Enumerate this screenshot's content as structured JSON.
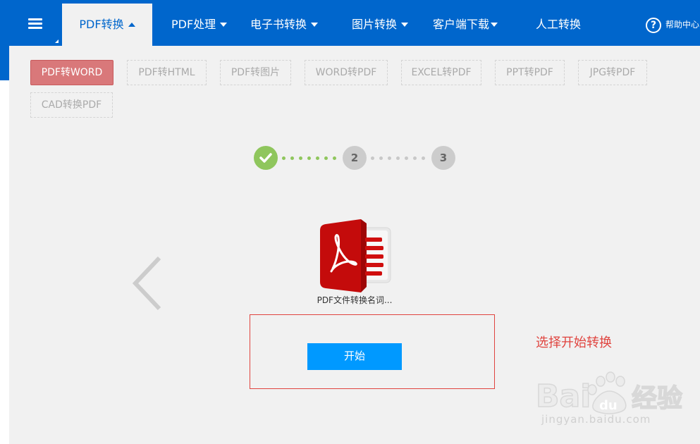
{
  "nav": {
    "items": [
      {
        "label": "PDF转换",
        "dropdown": true,
        "active": true
      },
      {
        "label": "PDF处理",
        "dropdown": true
      },
      {
        "label": "电子书转换",
        "dropdown": true
      },
      {
        "label": "图片转换",
        "dropdown": true
      },
      {
        "label": "客户端下载",
        "dropdown": true
      },
      {
        "label": "人工转换",
        "dropdown": false
      }
    ],
    "help_label": "帮助中心",
    "help_icon": "question-circle-icon"
  },
  "tabs": [
    "PDF转WORD",
    "PDF转HTML",
    "PDF转图片",
    "WORD转PDF",
    "EXCEL转PDF",
    "PPT转PDF",
    "JPG转PDF",
    "CAD转换PDF"
  ],
  "active_tab": "PDF转WORD",
  "steps": [
    {
      "label": "",
      "state": "done",
      "icon": "check-icon"
    },
    {
      "label": "2",
      "state": "pending"
    },
    {
      "label": "3",
      "state": "pending"
    }
  ],
  "file": {
    "name": "PDF文件转换名词...",
    "icon": "pdf-file-icon"
  },
  "start_button": "开始",
  "annotation": "选择开始转换",
  "watermark": {
    "text": "Bai  经验",
    "url": "jingyan.baidu.com"
  },
  "colors": {
    "nav_bg": "#0066cc",
    "panel_bg": "#f1f1f1",
    "active_tab": "#d9787a",
    "step_done": "#8fc65d",
    "start_button": "#0099ff",
    "annotation": "#e0443f"
  }
}
